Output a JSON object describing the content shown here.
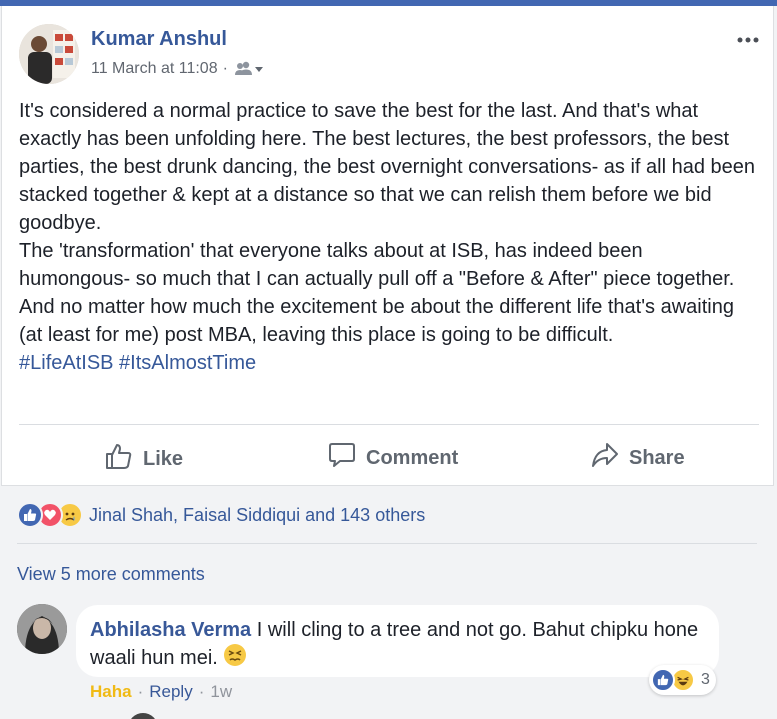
{
  "post": {
    "author": "Kumar Anshul",
    "timestamp": "11 March at 11:08",
    "separator": "·",
    "audience_icon": "friends-icon",
    "more_icon": "more-options-icon",
    "paragraphs": [
      "It's considered a normal practice to save the best for the last. And that's what exactly has been unfolding here. The best lectures, the best professors, the best parties, the best drunk dancing, the best overnight conversations- as if all had been stacked together & kept at a distance so that we can relish them before we bid goodbye.",
      "The 'transformation' that everyone talks about at ISB, has indeed been humongous- so much that I can actually pull off a \"Before & After\" piece together. And no matter how much the excitement be about the different life that's awaiting (at least for me) post MBA, leaving this place is going to be difficult."
    ],
    "hashtags": "#LifeAtISB #ItsAlmostTime"
  },
  "actions": {
    "like": "Like",
    "comment": "Comment",
    "share": "Share"
  },
  "reactions": {
    "icons": [
      "like-reaction-icon",
      "love-reaction-icon",
      "sad-reaction-icon"
    ],
    "summary": "Jinal Shah, Faisal Siddiqui and 143 others"
  },
  "comments": {
    "view_more": "View 5 more comments",
    "items": [
      {
        "author": "Abhilasha Verma",
        "text": "I will cling to a tree and not go. Bahut chipku hone waali hun mei.",
        "emoji_icon": "persevering-face-emoji",
        "reaction_icons": [
          "like-reaction-icon",
          "haha-reaction-icon"
        ],
        "reaction_count": "3",
        "user_reaction": "Haha",
        "reply": "Reply",
        "time": "1w",
        "sep": "·"
      }
    ]
  },
  "colors": {
    "link": "#365899",
    "haha": "#f0ba15",
    "like_blue": "#4267b2",
    "love_red": "#f25268",
    "page_bg": "#f2f3f5"
  }
}
